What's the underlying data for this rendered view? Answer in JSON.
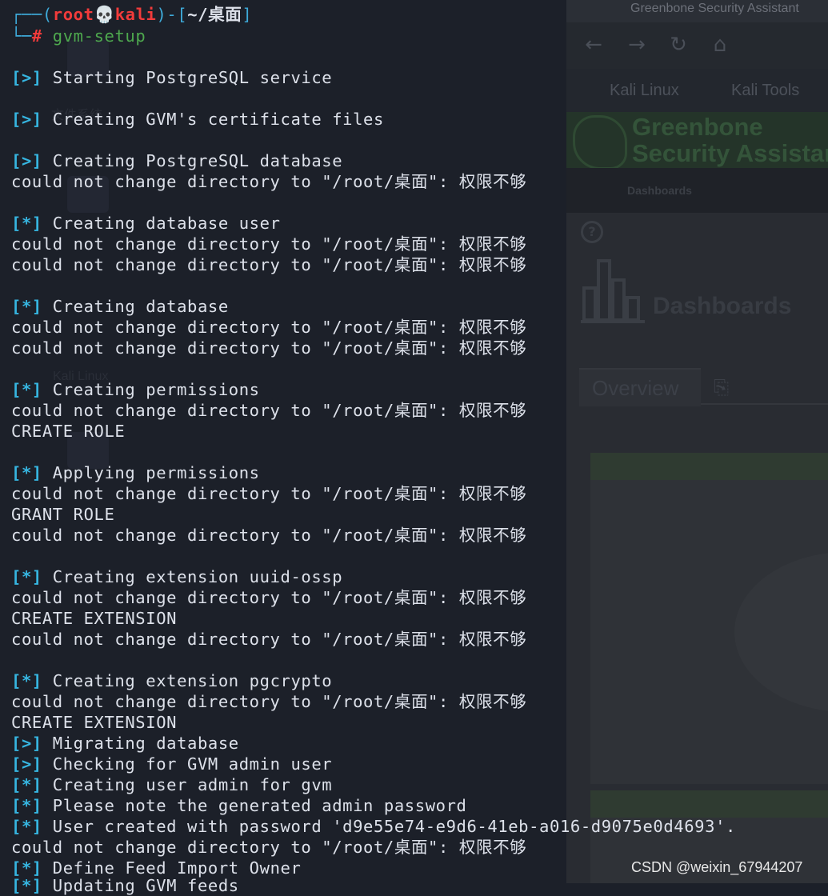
{
  "prompt": {
    "user": "root",
    "skull_glyph": "💀",
    "host": "kali",
    "cwd": "~/桌面",
    "command": "gvm-setup"
  },
  "lines": [
    {
      "marker": "[>]",
      "text": "Starting PostgreSQL service"
    },
    {
      "marker": "[>]",
      "text": "Creating GVM's certificate files"
    },
    {
      "marker": "[>]",
      "text": "Creating PostgreSQL database"
    },
    {
      "marker": "",
      "text": "could not change directory to \"/root/桌面\": 权限不够"
    },
    {
      "marker": "[*]",
      "text": "Creating database user"
    },
    {
      "marker": "",
      "text": "could not change directory to \"/root/桌面\": 权限不够"
    },
    {
      "marker": "",
      "text": "could not change directory to \"/root/桌面\": 权限不够"
    },
    {
      "marker": "[*]",
      "text": "Creating database"
    },
    {
      "marker": "",
      "text": "could not change directory to \"/root/桌面\": 权限不够"
    },
    {
      "marker": "",
      "text": "could not change directory to \"/root/桌面\": 权限不够"
    },
    {
      "marker": "[*]",
      "text": "Creating permissions"
    },
    {
      "marker": "",
      "text": "could not change directory to \"/root/桌面\": 权限不够"
    },
    {
      "marker": "",
      "text": "CREATE ROLE"
    },
    {
      "marker": "[*]",
      "text": "Applying permissions"
    },
    {
      "marker": "",
      "text": "could not change directory to \"/root/桌面\": 权限不够"
    },
    {
      "marker": "",
      "text": "GRANT ROLE"
    },
    {
      "marker": "",
      "text": "could not change directory to \"/root/桌面\": 权限不够"
    },
    {
      "marker": "[*]",
      "text": "Creating extension uuid-ossp"
    },
    {
      "marker": "",
      "text": "could not change directory to \"/root/桌面\": 权限不够"
    },
    {
      "marker": "",
      "text": "CREATE EXTENSION"
    },
    {
      "marker": "",
      "text": "could not change directory to \"/root/桌面\": 权限不够"
    },
    {
      "marker": "[*]",
      "text": "Creating extension pgcrypto"
    },
    {
      "marker": "",
      "text": "could not change directory to \"/root/桌面\": 权限不够"
    },
    {
      "marker": "",
      "text": "CREATE EXTENSION"
    },
    {
      "marker": "[>]",
      "text": "Migrating database"
    },
    {
      "marker": "[>]",
      "text": "Checking for GVM admin user"
    },
    {
      "marker": "[*]",
      "text": "Creating user admin for gvm"
    },
    {
      "marker": "[*]",
      "text": "Please note the generated admin password"
    },
    {
      "marker": "[*]",
      "text": "User created with password 'd9e55e74-e9d6-41eb-a016-d9075e0d4693'."
    },
    {
      "marker": "",
      "text": "could not change directory to \"/root/桌面\": 权限不够"
    },
    {
      "marker": "[*]",
      "text": "Define Feed Import Owner"
    },
    {
      "marker": "[*]",
      "text": "Updating GVM feeds"
    }
  ],
  "browser": {
    "tab_title": "Greenbone Security Assistant",
    "back_glyph": "←",
    "forward_glyph": "→",
    "reload_glyph": "↻",
    "home_glyph": "⌂",
    "bookmarks": [
      "Kali Linux",
      "Kali Tools"
    ],
    "gsa_line1": "Greenbone",
    "gsa_line2": "Security Assistant",
    "menu_item": "Dashboards",
    "help_glyph": "?",
    "page_title": "Dashboards",
    "tab_overview": "Overview",
    "new_tab_glyph": "⎘"
  },
  "desktop": {
    "ghost_label_1": "文件系统",
    "ghost_label_2": "Kali Linux"
  },
  "watermark": "CSDN @weixin_67944207",
  "colors": {
    "terminal_bg": "#1c2029",
    "prompt_bracket": "#3eaad9",
    "prompt_user": "#f23b3b",
    "command": "#4ea84e",
    "marker": "#36b5e0",
    "text": "#dde1ea"
  }
}
